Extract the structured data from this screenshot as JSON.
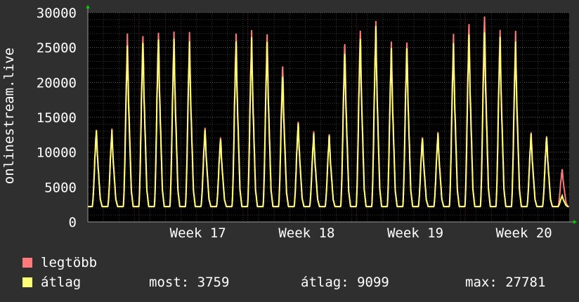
{
  "chart_data": {
    "type": "line",
    "ylabel": "onlinestream.live",
    "ylim": [
      0,
      30000
    ],
    "yticks": [
      0,
      5000,
      10000,
      15000,
      20000,
      25000,
      30000
    ],
    "xlim": [
      0,
      31
    ],
    "xticks": [
      {
        "value": 7,
        "label": "Week 17"
      },
      {
        "value": 14,
        "label": "Week 18"
      },
      {
        "value": 21,
        "label": "Week 19"
      },
      {
        "value": 28,
        "label": "Week 20"
      }
    ],
    "grid": true,
    "daily_peaks": {
      "max": [
        13300,
        13200,
        26700,
        27000,
        27500,
        27000,
        26800,
        13600,
        12300,
        26900,
        27000,
        26900,
        22700,
        14400,
        12800,
        12500,
        25900,
        27700,
        28400,
        25500,
        26000,
        12300,
        12800,
        26500,
        28500,
        30000,
        27500,
        26900,
        12800,
        12500,
        7600
      ],
      "average": [
        13200,
        13000,
        25000,
        26000,
        26500,
        26000,
        25500,
        13300,
        12000,
        25800,
        26000,
        25800,
        21200,
        14200,
        12500,
        12300,
        24500,
        26500,
        27700,
        24600,
        25200,
        12100,
        12600,
        25200,
        27000,
        27700,
        26500,
        25400,
        12600,
        12300,
        3759
      ]
    },
    "daily_trough": 2200,
    "series": [
      {
        "name": "legtöbb",
        "color": "#ff7a7a"
      },
      {
        "name": "átlag",
        "color": "#ffff77"
      }
    ],
    "colors": {
      "background": "#2f2f2f",
      "plot": "#000000",
      "grid": "#666666",
      "axis": "#999999",
      "arrow": "#00cc00"
    }
  },
  "legend": {
    "max_label": "legtöbb",
    "avg_label": "átlag",
    "now_text": "most: 3759",
    "avg_text": "átlag: 9099",
    "max_text": "max: 27781"
  }
}
